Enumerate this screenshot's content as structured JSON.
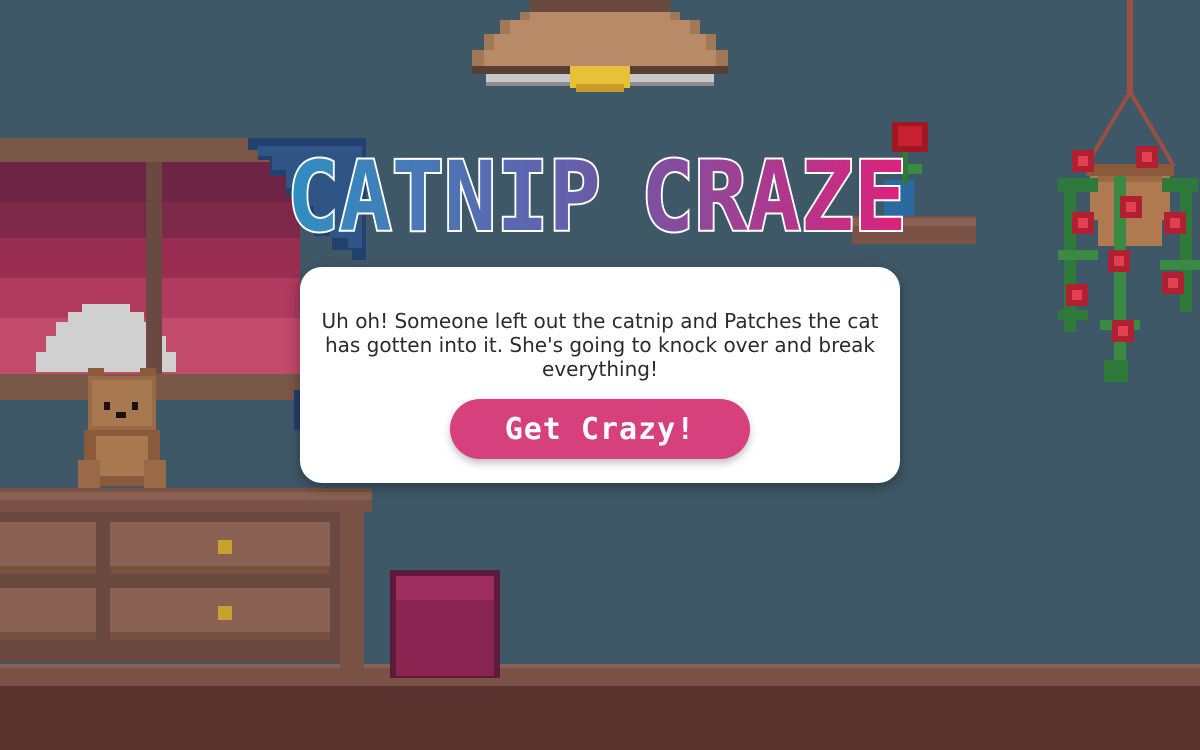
{
  "game": {
    "title_word_1": "CATNIP",
    "title_word_2": "CRAZE",
    "intro_text": "Uh oh! Someone left out the catnip and Patches the cat has gotten into it. She's going to knock over and break everything!",
    "start_button_label": "Get Crazy!"
  },
  "colors": {
    "wall": "#3f5868",
    "floor": "#5a3530",
    "button": "#d6407c",
    "title_gradient": [
      "#2f8fc0",
      "#6a5aa8",
      "#e0207a"
    ]
  },
  "scene_objects": [
    "ceiling-lamp",
    "window-with-sunset",
    "curtain",
    "teddy-bear",
    "dresser",
    "cushion-stool",
    "wall-shelf",
    "rose-vase",
    "hanging-plant",
    "floor"
  ]
}
